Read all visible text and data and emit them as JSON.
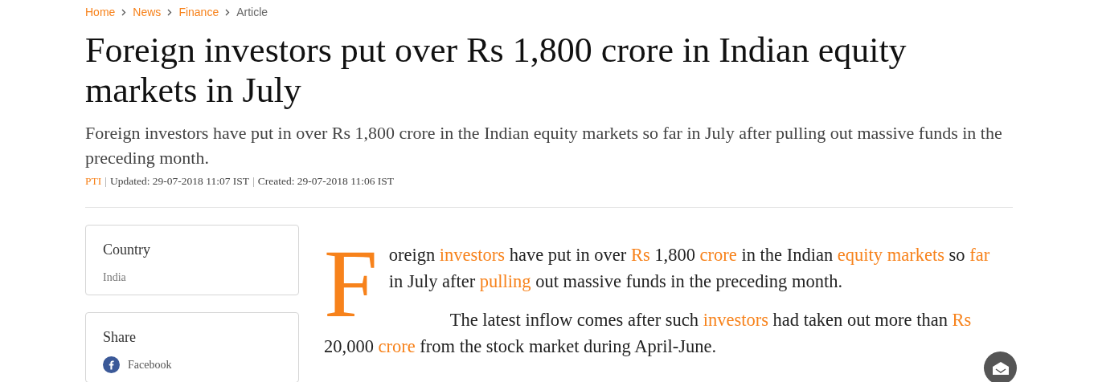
{
  "breadcrumb": [
    {
      "label": "Home",
      "kind": "link"
    },
    {
      "label": "News",
      "kind": "link"
    },
    {
      "label": "Finance",
      "kind": "link"
    },
    {
      "label": "Article",
      "kind": "current"
    }
  ],
  "title": "Foreign investors put over Rs 1,800 crore in Indian equity markets in July",
  "summary": "Foreign investors have put in over Rs 1,800 crore in the Indian equity markets so far in July after pulling out massive funds in the preceding month.",
  "byline": {
    "source": "PTI",
    "separator": "|",
    "updated": "Updated: 29-07-2018 11:07 IST",
    "created": "Created: 29-07-2018 11:06 IST"
  },
  "sidebar": [
    {
      "heading": "Country",
      "items": [
        {
          "kind": "text",
          "label": "India"
        }
      ]
    },
    {
      "heading": "Share",
      "items": [
        {
          "kind": "facebook",
          "label": "Facebook"
        }
      ]
    }
  ],
  "article": {
    "drop_cap": "F",
    "paragraphs": [
      [
        {
          "text": "oreign ",
          "kind": "text"
        },
        {
          "text": "investors",
          "kind": "link"
        },
        {
          "text": " have put in over ",
          "kind": "text"
        },
        {
          "text": "Rs",
          "kind": "link"
        },
        {
          "text": " 1,800 ",
          "kind": "text"
        },
        {
          "text": "crore",
          "kind": "link"
        },
        {
          "text": " in the Indian ",
          "kind": "text"
        },
        {
          "text": "equity markets",
          "kind": "link"
        },
        {
          "text": " so ",
          "kind": "text"
        },
        {
          "text": "far",
          "kind": "link"
        },
        {
          "text": " in July after ",
          "kind": "text"
        },
        {
          "text": "pulling",
          "kind": "link"
        },
        {
          "text": " out massive funds in the preceding month.",
          "kind": "text"
        }
      ],
      [
        {
          "text": "The latest inflow comes after such ",
          "kind": "text"
        },
        {
          "text": "investors",
          "kind": "link"
        },
        {
          "text": " had taken out more than ",
          "kind": "text"
        },
        {
          "text": "Rs",
          "kind": "link"
        },
        {
          "text": " 20,000 ",
          "kind": "text"
        },
        {
          "text": "crore",
          "kind": "link"
        },
        {
          "text": " from the stock market during April-June.",
          "kind": "text"
        }
      ]
    ]
  }
}
